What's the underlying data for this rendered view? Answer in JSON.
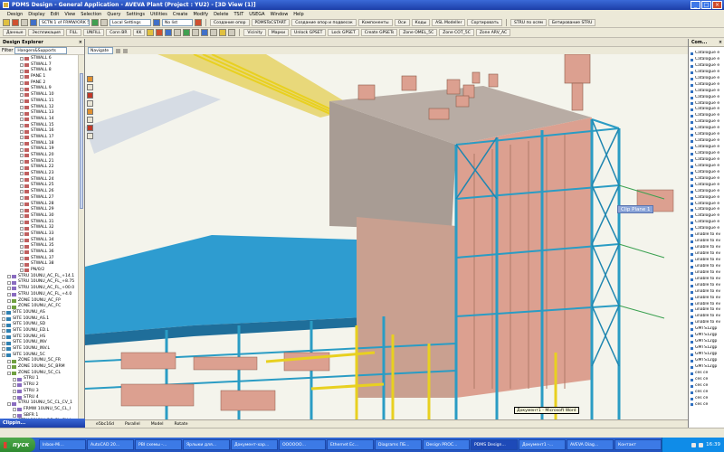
{
  "window": {
    "title": "PDMS Design - General Application - AVEVA Plant (Project : YU2) - [3D View (1)]"
  },
  "menu": [
    "Design",
    "Display",
    "Edit",
    "View",
    "Selection",
    "Query",
    "Settings",
    "Utilities",
    "Create",
    "Modify",
    "Delete",
    "TSIT",
    "USEGA",
    "Window",
    "Help"
  ],
  "toolbar1": {
    "buttons": [
      "Создание опор",
      "PDMSToCSTART",
      "Создание опор и подвесок",
      "Компоненты",
      "Оси",
      "Коды",
      "ASL Modeller",
      "Сортировать",
      "STRU по осям",
      "Бетирование STRU"
    ],
    "element_combo": "SCTN 1 of FRMW/ORK 50/UH",
    "settings_combo": "Local Settings",
    "tag_combo": "No list"
  },
  "toolbar2": {
    "buttons": [
      "Данные",
      "Экспликация",
      "FILL",
      "UNFILL",
      "Conn BR",
      "KK",
      "Vicinity",
      "Марки",
      "Unlock GPSET",
      "Lock GPSET",
      "Create GPSETs",
      "Zone OMEL_5C",
      "Zone СОТ_5С",
      "Zone ARV_AC"
    ]
  },
  "explorer": {
    "title": "Design Explorer",
    "filter_label": "Filter",
    "filter_value": "Hangers&Supports",
    "tree": [
      "STWALL 6",
      "STWALL 7",
      "STWALL 8",
      "PANE 1",
      "PANE 2",
      "STWALL 9",
      "STWALL 10",
      "STWALL 11",
      "STWALL 12",
      "STWALL 13",
      "STWALL 14",
      "STWALL 15",
      "STWALL 16",
      "STWALL 17",
      "STWALL 18",
      "STWALL 19",
      "STWALL 20",
      "STWALL 21",
      "STWALL 22",
      "STWALL 23",
      "STWALL 24",
      "STWALL 25",
      "STWALL 26",
      "STWALL 27",
      "STWALL 28",
      "STWALL 29",
      "STWALL 30",
      "STWALL 31",
      "STWALL 32",
      "STWALL 33",
      "STWALL 34",
      "STWALL 35",
      "STWALL 36",
      "STWALL 37",
      "STWALL 38",
      "PN/0/2",
      "STRU 10UNU_AC_FL_+14.1",
      "STRU 10UNU_AC_FL_+8.75",
      "STRU 10UNU_AC_FL_+00.0",
      "STRU 10UNU_AC_FL_+4.0",
      "ZONE 10UNU_AC_FP",
      "ZONE 10UNU_AC_FC",
      "SITE 10UNU_AS",
      "SITE 10UNU_AS.1",
      "SITE 10UNU_SD",
      "SITE 10UNU_ED.L",
      "SITE 10UNU_HS",
      "SITE 10UNU_INV",
      "SITE 10UNU_INV.L",
      "SITE 10UNU_5C",
      "ZONE 10UNU_5C_FR",
      "ZONE 10UNU_5C_BRM",
      "ZONE 10UNU_5C_CL",
      "STRU 1",
      "STRU 2",
      "STRU 3",
      "STRU 4",
      "STRU 10UNU_5C_CL_CV_1",
      "FRMW 10UNU_5C_CL_I",
      "SBFR 1",
      "STRU 10UNU_5C_CL_CV_I"
    ]
  },
  "clip_panel_title": "Clippin...",
  "viewbar": {
    "nav_combo": "Navigate"
  },
  "viewport": {
    "clip_plane_label": "Clip Plane 1"
  },
  "statusbar": [
    "e5bc16d",
    "Parallel",
    "Model",
    "Rotate"
  ],
  "tooltip": "Документ1 - Microsoft Word",
  "rightpanel": {
    "title": "Com...",
    "items": [
      "Catalogue e",
      "Catalogue e",
      "Catalogue e",
      "Catalogue e",
      "Catalogue e",
      "Catalogue e",
      "Catalogue e",
      "Catalogue e",
      "Catalogue e",
      "Catalogue e",
      "Catalogue e",
      "Catalogue e",
      "Catalogue e",
      "Catalogue e",
      "Catalogue e",
      "Catalogue e",
      "Catalogue e",
      "Catalogue e",
      "Catalogue e",
      "Catalogue e",
      "Catalogue e",
      "Catalogue e",
      "Catalogue e",
      "Catalogue e",
      "Catalogue e",
      "Catalogue e",
      "Catalogue e",
      "Catalogue e",
      "Catalogue e",
      "unable to ev",
      "unable to ev",
      "unable to ev",
      "unable to ev",
      "unable to ev",
      "unable to ev",
      "unable to ev",
      "unable to ev",
      "unable to ev",
      "unable to ev",
      "unable to ev",
      "unable to ev",
      "unable to ev",
      "unable to ev",
      "unable to ev",
      "GMTS12gp",
      "GMTS12gp",
      "GMTS12gp",
      "GMTS12gp",
      "GMTS12gp",
      "GMTS12gp",
      "GMTS12gp",
      "ces ce",
      "ces ce",
      "ces ce",
      "ces ce",
      "ces ce",
      "ces ce"
    ]
  },
  "taskbar": {
    "start": "пуск",
    "tasks": [
      "Inbox-Mi...",
      "AutoCAD 20...",
      "PBI схемы -...",
      "Ярлыки для...",
      "Документ-хар...",
      "ОООООО...",
      "Ethernet Ес...",
      "Diagrams ПБ...",
      "Design PROC...",
      "PDMS Design...",
      "Документ1 -...",
      "AVEVA Diag...",
      "Контакт"
    ],
    "time": "16:39"
  },
  "colors": {
    "steel_blue": "#2a9cc4",
    "pipe_yellow": "#e8d020",
    "equipment_pink": "#dca090",
    "wall_grey": "#a89c94"
  }
}
